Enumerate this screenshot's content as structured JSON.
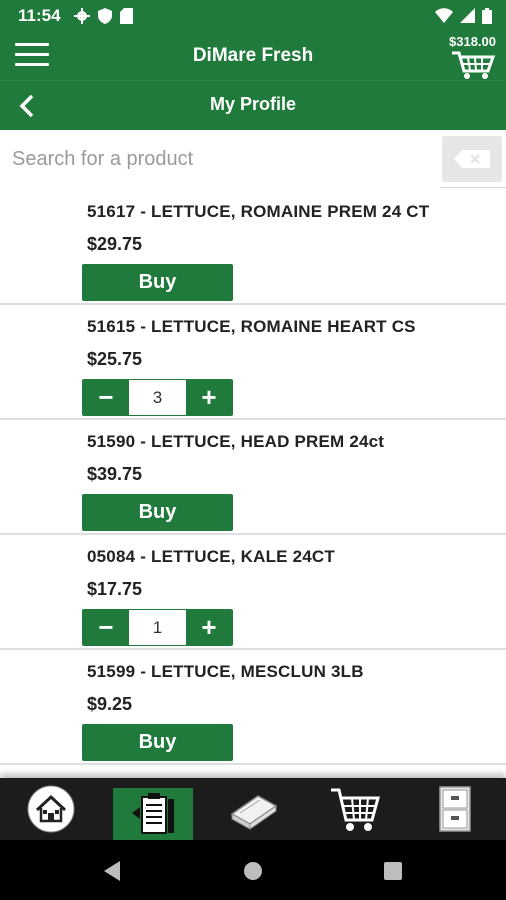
{
  "status_bar": {
    "time": "11:54"
  },
  "app_bar": {
    "title": "DiMare Fresh",
    "cart_total": "$318.00"
  },
  "sub_bar": {
    "title": "My Profile"
  },
  "search": {
    "placeholder": "Search for a product",
    "value": ""
  },
  "products": [
    {
      "name": "51617 - LETTUCE, ROMAINE PREM 24 CT",
      "price": "$29.75",
      "action": "Buy"
    },
    {
      "name": "51615 - LETTUCE, ROMAINE HEART CS",
      "price": "$25.75",
      "quantity": "3"
    },
    {
      "name": "51590 - LETTUCE, HEAD PREM 24ct",
      "price": "$39.75",
      "action": "Buy"
    },
    {
      "name": "05084 - LETTUCE, KALE 24CT",
      "price": "$17.75",
      "quantity": "1"
    },
    {
      "name": "51599 - LETTUCE, MESCLUN 3LB",
      "price": "$9.25",
      "action": "Buy"
    }
  ],
  "stepper": {
    "minus": "−",
    "plus": "+"
  },
  "bottom_nav": [
    {
      "icon": "home-icon"
    },
    {
      "icon": "order-guide-icon",
      "active": true
    },
    {
      "icon": "catalog-book-icon"
    },
    {
      "icon": "shopping-cart-icon"
    },
    {
      "icon": "file-cabinet-icon"
    }
  ],
  "colors": {
    "primary_green": "#1f7a3b",
    "nav_dark": "#1c1c1c"
  }
}
